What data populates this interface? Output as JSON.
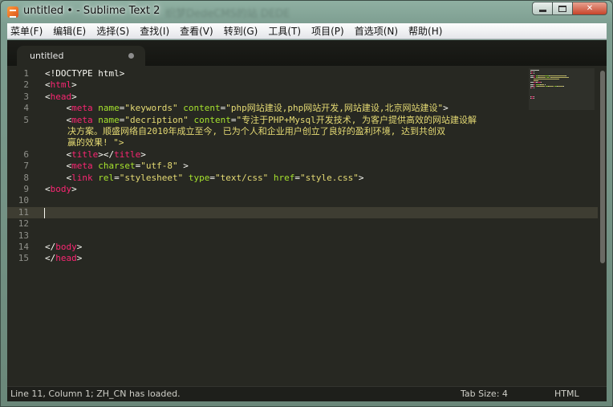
{
  "window": {
    "title": "untitled • - Sublime Text 2",
    "background_title": "织梦DedeCMS的站 DEDE",
    "close_glyph": "✕"
  },
  "menu": [
    "菜单(F)",
    "编辑(E)",
    "选择(S)",
    "查找(I)",
    "查看(V)",
    "转到(G)",
    "工具(T)",
    "项目(P)",
    "首选项(N)",
    "帮助(H)"
  ],
  "tab": {
    "label": "untitled",
    "modified": true
  },
  "editor": {
    "current_line": 11,
    "lines": [
      {
        "n": "1",
        "segs": [
          [
            "pl",
            "<!DOCTYPE html>"
          ]
        ]
      },
      {
        "n": "2",
        "segs": [
          [
            "pl",
            "<"
          ],
          [
            "tag",
            "html"
          ],
          [
            "pl",
            ">"
          ]
        ]
      },
      {
        "n": "3",
        "segs": [
          [
            "pl",
            "<"
          ],
          [
            "tag",
            "head"
          ],
          [
            "pl",
            ">"
          ]
        ]
      },
      {
        "n": "4",
        "segs": [
          [
            "pl",
            "    <"
          ],
          [
            "tag",
            "meta"
          ],
          [
            "pl",
            " "
          ],
          [
            "attr",
            "name"
          ],
          [
            "pl",
            "="
          ],
          [
            "str",
            "\"keywords\""
          ],
          [
            "pl",
            " "
          ],
          [
            "attr",
            "content"
          ],
          [
            "pl",
            "="
          ],
          [
            "str",
            "\"php网站建设,php网站开发,网站建设,北京网站建设\""
          ],
          [
            "pl",
            ">"
          ]
        ]
      },
      {
        "n": "5",
        "segs": [
          [
            "pl",
            "    <"
          ],
          [
            "tag",
            "meta"
          ],
          [
            "pl",
            " "
          ],
          [
            "attr",
            "name"
          ],
          [
            "pl",
            "="
          ],
          [
            "str",
            "\"decription\""
          ],
          [
            "pl",
            " "
          ],
          [
            "attr",
            "content"
          ],
          [
            "pl",
            "="
          ],
          [
            "str",
            "\"专注于PHP+Mysql开发技术, 为客户提供高效的网站建设解"
          ]
        ]
      },
      {
        "cont": "决方案。顺盛网络自2010年成立至今, 已为个人和企业用户创立了良好的盈利环境, 达到共创双"
      },
      {
        "cont": "赢的效果! \">"
      },
      {
        "n": "6",
        "segs": [
          [
            "pl",
            "    <"
          ],
          [
            "tag",
            "title"
          ],
          [
            "pl",
            "></"
          ],
          [
            "tag",
            "title"
          ],
          [
            "pl",
            ">"
          ]
        ]
      },
      {
        "n": "7",
        "segs": [
          [
            "pl",
            "    <"
          ],
          [
            "tag",
            "meta"
          ],
          [
            "pl",
            " "
          ],
          [
            "attr",
            "charset"
          ],
          [
            "pl",
            "="
          ],
          [
            "str",
            "\"utf-8\""
          ],
          [
            "pl",
            " >"
          ]
        ]
      },
      {
        "n": "8",
        "segs": [
          [
            "pl",
            "    <"
          ],
          [
            "tag",
            "link"
          ],
          [
            "pl",
            " "
          ],
          [
            "attr",
            "rel"
          ],
          [
            "pl",
            "="
          ],
          [
            "str",
            "\"stylesheet\""
          ],
          [
            "pl",
            " "
          ],
          [
            "attr",
            "type"
          ],
          [
            "pl",
            "="
          ],
          [
            "str",
            "\"text/css\""
          ],
          [
            "pl",
            " "
          ],
          [
            "attr",
            "href"
          ],
          [
            "pl",
            "="
          ],
          [
            "str",
            "\"style.css\""
          ],
          [
            "pl",
            ">"
          ]
        ]
      },
      {
        "n": "9",
        "segs": [
          [
            "pl",
            "<"
          ],
          [
            "tag",
            "body"
          ],
          [
            "pl",
            ">"
          ]
        ]
      },
      {
        "n": "10",
        "segs": []
      },
      {
        "n": "11",
        "segs": []
      },
      {
        "n": "12",
        "segs": []
      },
      {
        "n": "13",
        "segs": []
      },
      {
        "n": "14",
        "segs": [
          [
            "pl",
            "</"
          ],
          [
            "tag",
            "body"
          ],
          [
            "pl",
            ">"
          ]
        ]
      },
      {
        "n": "15",
        "segs": [
          [
            "pl",
            "</"
          ],
          [
            "tag",
            "head"
          ],
          [
            "pl",
            ">"
          ]
        ]
      }
    ]
  },
  "status": {
    "position_msg": "Line 11, Column 1; ZH_CN has loaded.",
    "tab_size": "Tab Size: 4",
    "syntax": "HTML"
  },
  "colors": {
    "background": "#272822",
    "tag": "#f92672",
    "attribute": "#a6e22e",
    "string": "#e6db74",
    "plain": "#f8f8f2",
    "line_highlight": "#3e3d32"
  }
}
